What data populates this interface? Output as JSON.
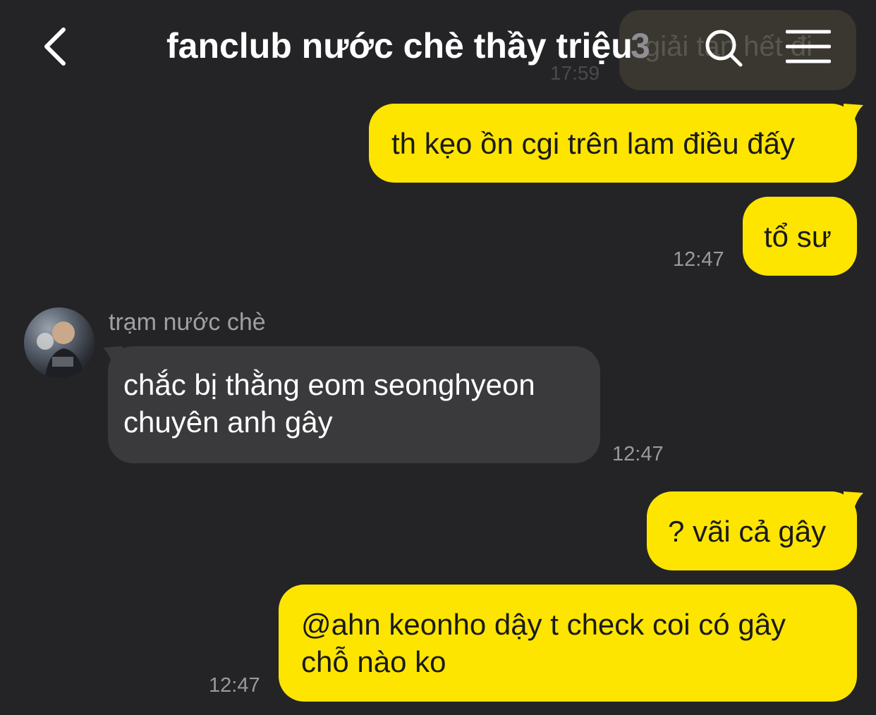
{
  "header": {
    "back_label": "back",
    "title": "fanclub nước chè thầy triệu",
    "member_count": "3"
  },
  "previous_message": {
    "text": "giải tán hết đi",
    "time": "17:59"
  },
  "messages": [
    {
      "from": "me",
      "text": "th kẹo ồn cgi trên lam điều đấy",
      "time": ""
    },
    {
      "from": "me",
      "text": "tổ sư",
      "time": "12:47"
    },
    {
      "from": "trạm nước chè",
      "text_line1": "chắc bị thằng eom seonghyeon",
      "text_line2": "chuyên anh gây",
      "time": "12:47"
    },
    {
      "from": "me",
      "text": "? vãi cả gây",
      "time": ""
    },
    {
      "from": "me",
      "text_line1": "@ahn keonho dậy t check coi có gây",
      "text_line2": "chỗ nào ko",
      "time": "12:47"
    }
  ],
  "sender": {
    "name": "trạm nước chè"
  },
  "icons": {
    "back": "chevron-left-icon",
    "search": "search-icon",
    "menu": "hamburger-menu-icon",
    "avatar": "avatar"
  },
  "colors": {
    "background": "#242426",
    "my_bubble": "#fee500",
    "their_bubble": "#3a3a3c",
    "time_text": "#9a9a9e"
  }
}
